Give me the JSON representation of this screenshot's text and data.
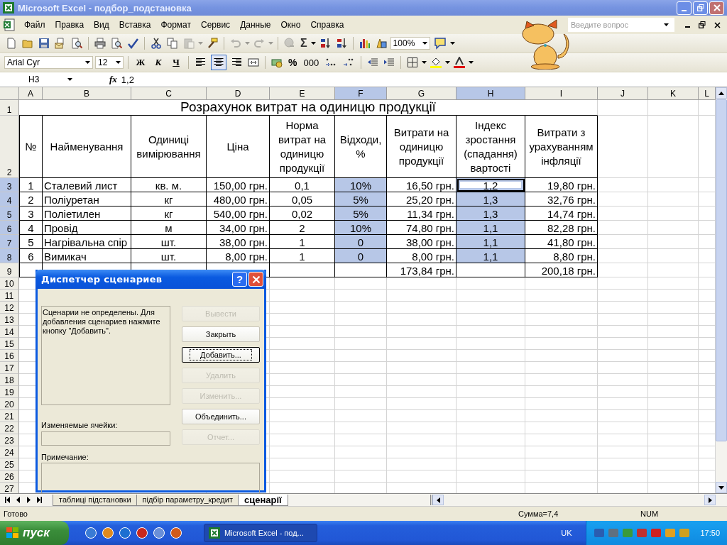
{
  "window": {
    "title": "Microsoft Excel - подбор_подстановка"
  },
  "menu": [
    "Файл",
    "Правка",
    "Вид",
    "Вставка",
    "Формат",
    "Сервис",
    "Данные",
    "Окно",
    "Справка"
  ],
  "help_field": {
    "placeholder": "Введите вопрос"
  },
  "toolbar": [
    {
      "kind": "new",
      "disabled": false
    },
    {
      "kind": "open",
      "disabled": false
    },
    {
      "kind": "save",
      "disabled": false
    },
    {
      "kind": "permission",
      "disabled": false
    },
    {
      "kind": "research",
      "disabled": false
    },
    {
      "kind": "separator"
    },
    {
      "kind": "print",
      "disabled": false
    },
    {
      "kind": "preview",
      "disabled": false
    },
    {
      "kind": "spell",
      "disabled": false
    },
    {
      "kind": "separator"
    },
    {
      "kind": "cut",
      "disabled": false
    },
    {
      "kind": "copy",
      "disabled": false
    },
    {
      "kind": "paste",
      "disabled": true
    },
    {
      "kind": "caret",
      "disabled": true
    },
    {
      "kind": "painter",
      "disabled": false
    },
    {
      "kind": "separator"
    },
    {
      "kind": "undo",
      "disabled": true
    },
    {
      "kind": "caret",
      "disabled": true
    },
    {
      "kind": "redo",
      "disabled": true
    },
    {
      "kind": "caret",
      "disabled": true
    },
    {
      "kind": "separator"
    },
    {
      "kind": "hyperlink",
      "disabled": true
    },
    {
      "kind": "sum",
      "disabled": false
    },
    {
      "kind": "caret",
      "disabled": false
    },
    {
      "kind": "sort-asc",
      "disabled": false
    },
    {
      "kind": "sort-desc",
      "disabled": false
    },
    {
      "kind": "separator"
    },
    {
      "kind": "chart",
      "disabled": false
    },
    {
      "kind": "drawing",
      "disabled": false
    },
    {
      "kind": "zoom"
    },
    {
      "kind": "help",
      "disabled": false
    },
    {
      "kind": "caret",
      "disabled": false
    }
  ],
  "autosum": "Σ",
  "zoom": "100%",
  "formatting": {
    "font": "Arial Cyr",
    "size": "12",
    "styles": [
      "Ж",
      "К",
      "Ч"
    ],
    "align": [
      {
        "kind": "left",
        "selected": false
      },
      {
        "kind": "center",
        "selected": true
      },
      {
        "kind": "right",
        "selected": false
      }
    ],
    "percent": "%",
    "thousands": "000"
  },
  "formula_bar": {
    "name_box": "H3",
    "fx": "fx",
    "value": "1,2"
  },
  "sheet": {
    "columns": [
      "A",
      "B",
      "C",
      "D",
      "E",
      "F",
      "G",
      "H",
      "I",
      "J",
      "K",
      "L"
    ],
    "rows": [
      {
        "number": "1",
        "kind": "title",
        "text": "Розрахунок витрат на одиницю продукції"
      },
      {
        "number": "2",
        "kind": "header",
        "cells": [
          "№",
          "Найменування",
          "Одиниці вимірювання",
          "Ціна",
          "Норма витрат на одиницю продукції",
          "Відходи, %",
          "Витрати на одиницю продукції",
          "Індекс зростання (спадання) вартості",
          "Витрати з урахуванням інфляції"
        ]
      },
      {
        "number": "3",
        "kind": "data",
        "cells": [
          {
            "text": "1",
            "selected": false,
            "active": false
          },
          {
            "text": "Сталевий лист",
            "selected": false,
            "active": false
          },
          {
            "text": "кв. м.",
            "selected": false,
            "active": false
          },
          {
            "text": "150,00 грн.",
            "selected": false,
            "active": false
          },
          {
            "text": "0,1",
            "selected": false,
            "active": false
          },
          {
            "text": "10%",
            "selected": true,
            "active": false
          },
          {
            "text": "16,50 грн.",
            "selected": false,
            "active": false
          },
          {
            "text": "1,2",
            "selected": true,
            "active": true
          },
          {
            "text": "19,80 грн.",
            "selected": false,
            "active": false
          }
        ]
      },
      {
        "number": "4",
        "kind": "data",
        "cells": [
          {
            "text": "2",
            "selected": false,
            "active": false
          },
          {
            "text": "Поліуретан",
            "selected": false,
            "active": false
          },
          {
            "text": "кг",
            "selected": false,
            "active": false
          },
          {
            "text": "480,00 грн.",
            "selected": false,
            "active": false
          },
          {
            "text": "0,05",
            "selected": false,
            "active": false
          },
          {
            "text": "5%",
            "selected": true,
            "active": false
          },
          {
            "text": "25,20 грн.",
            "selected": false,
            "active": false
          },
          {
            "text": "1,3",
            "selected": true,
            "active": false
          },
          {
            "text": "32,76 грн.",
            "selected": false,
            "active": false
          }
        ]
      },
      {
        "number": "5",
        "kind": "data",
        "cells": [
          {
            "text": "3",
            "selected": false,
            "active": false
          },
          {
            "text": "Поліетилен",
            "selected": false,
            "active": false
          },
          {
            "text": "кг",
            "selected": false,
            "active": false
          },
          {
            "text": "540,00 грн.",
            "selected": false,
            "active": false
          },
          {
            "text": "0,02",
            "selected": false,
            "active": false
          },
          {
            "text": "5%",
            "selected": true,
            "active": false
          },
          {
            "text": "11,34 грн.",
            "selected": false,
            "active": false
          },
          {
            "text": "1,3",
            "selected": true,
            "active": false
          },
          {
            "text": "14,74 грн.",
            "selected": false,
            "active": false
          }
        ]
      },
      {
        "number": "6",
        "kind": "data",
        "cells": [
          {
            "text": "4",
            "selected": false,
            "active": false
          },
          {
            "text": "Провід",
            "selected": false,
            "active": false
          },
          {
            "text": "м",
            "selected": false,
            "active": false
          },
          {
            "text": "34,00 грн.",
            "selected": false,
            "active": false
          },
          {
            "text": "2",
            "selected": false,
            "active": false
          },
          {
            "text": "10%",
            "selected": true,
            "active": false
          },
          {
            "text": "74,80 грн.",
            "selected": false,
            "active": false
          },
          {
            "text": "1,1",
            "selected": true,
            "active": false
          },
          {
            "text": "82,28 грн.",
            "selected": false,
            "active": false
          }
        ]
      },
      {
        "number": "7",
        "kind": "data",
        "cells": [
          {
            "text": "5",
            "selected": false,
            "active": false
          },
          {
            "text": "Нагрівальна спір",
            "selected": false,
            "active": false
          },
          {
            "text": "шт.",
            "selected": false,
            "active": false
          },
          {
            "text": "38,00 грн.",
            "selected": false,
            "active": false
          },
          {
            "text": "1",
            "selected": false,
            "active": false
          },
          {
            "text": "0",
            "selected": true,
            "active": false
          },
          {
            "text": "38,00 грн.",
            "selected": false,
            "active": false
          },
          {
            "text": "1,1",
            "selected": true,
            "active": false
          },
          {
            "text": "41,80 грн.",
            "selected": false,
            "active": false
          }
        ]
      },
      {
        "number": "8",
        "kind": "data",
        "cells": [
          {
            "text": "6",
            "selected": false,
            "active": false
          },
          {
            "text": "Вимикач",
            "selected": false,
            "active": false
          },
          {
            "text": "шт.",
            "selected": false,
            "active": false
          },
          {
            "text": "8,00 грн.",
            "selected": false,
            "active": false
          },
          {
            "text": "1",
            "selected": false,
            "active": false
          },
          {
            "text": "0",
            "selected": true,
            "active": false
          },
          {
            "text": "8,00 грн.",
            "selected": false,
            "active": false
          },
          {
            "text": "1,1",
            "selected": true,
            "active": false
          },
          {
            "text": "8,80 грн.",
            "selected": false,
            "active": false
          }
        ]
      },
      {
        "number": "9",
        "kind": "total",
        "cells": [
          null,
          null,
          null,
          null,
          null,
          null,
          "173,84 грн.",
          null,
          "200,18 грн."
        ]
      },
      {
        "number": "10",
        "kind": "empty"
      },
      {
        "number": "11",
        "kind": "empty"
      },
      {
        "number": "12",
        "kind": "empty"
      },
      {
        "number": "13",
        "kind": "empty"
      },
      {
        "number": "14",
        "kind": "empty"
      },
      {
        "number": "15",
        "kind": "empty"
      },
      {
        "number": "16",
        "kind": "empty"
      },
      {
        "number": "17",
        "kind": "empty"
      },
      {
        "number": "18",
        "kind": "empty"
      },
      {
        "number": "19",
        "kind": "empty"
      },
      {
        "number": "20",
        "kind": "empty"
      },
      {
        "number": "21",
        "kind": "empty"
      },
      {
        "number": "22",
        "kind": "empty"
      },
      {
        "number": "23",
        "kind": "empty"
      },
      {
        "number": "24",
        "kind": "empty"
      },
      {
        "number": "25",
        "kind": "empty"
      },
      {
        "number": "26",
        "kind": "empty"
      },
      {
        "number": "27",
        "kind": "empty"
      }
    ]
  },
  "dialog": {
    "title": "Диспетчер сценариев",
    "help": "?",
    "message": "Сценарии не определены. Для добавления сценариев нажмите кнопку \"Добавить\".",
    "buttons": [
      {
        "label": "Вывести",
        "disabled": true,
        "default": false
      },
      {
        "label": "Закрыть",
        "disabled": false,
        "default": false
      },
      {
        "label": "Добавить...",
        "disabled": false,
        "default": true
      },
      {
        "label": "Удалить",
        "disabled": true,
        "default": false
      },
      {
        "label": "Изменить...",
        "disabled": true,
        "default": false
      },
      {
        "label": "Объединить...",
        "disabled": false,
        "default": false
      },
      {
        "label": "Отчет...",
        "disabled": true,
        "default": false
      }
    ],
    "changing_cells_label": "Изменяемые ячейки:",
    "comment_label": "Примечание:"
  },
  "sheet_tabs": [
    {
      "label": "таблиці підстановки",
      "selected": false
    },
    {
      "label": "підбір параметру_кредит",
      "selected": false
    },
    {
      "label": "сценарії",
      "selected": true
    }
  ],
  "status_bar": {
    "status": "Готово",
    "sum": "Сумма=7,4",
    "mode": "NUM"
  },
  "taskbar": {
    "start": "пуск",
    "tasks": [
      "Microsoft Excel - под..."
    ],
    "language": "UK",
    "clock": "17:50"
  }
}
